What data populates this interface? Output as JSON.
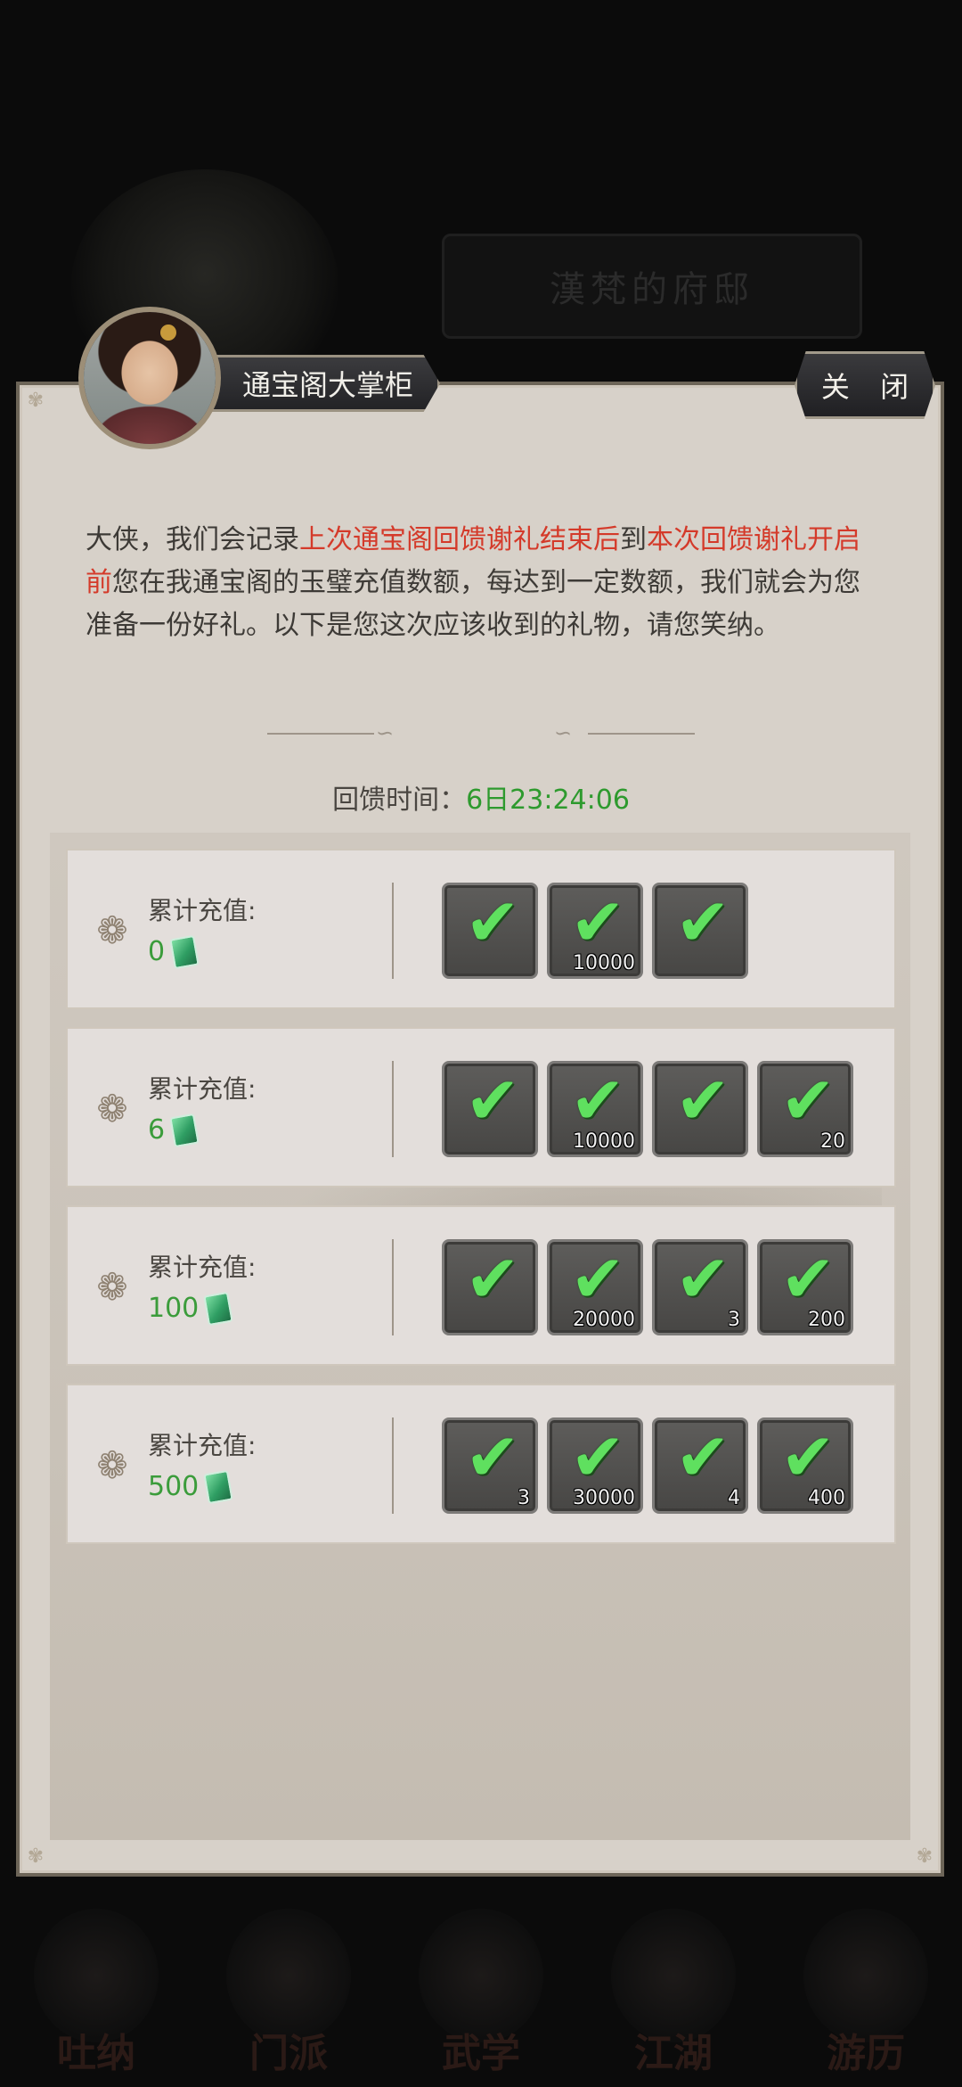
{
  "background": {
    "location_title": "漢梵的府邸",
    "bottom_nav": [
      "吐纳",
      "门派",
      "武学",
      "江湖",
      "游历"
    ]
  },
  "dialog": {
    "npc_name": "通宝阁大掌柜",
    "close_label": "关 闭",
    "description": {
      "part1": "大侠，我们会记录",
      "highlight1": "上次通宝阁回馈谢礼结束后",
      "part2": "到",
      "highlight2": "本次回馈谢礼开启前",
      "part3": "您在我通宝阁的玉璧充值数额，每达到一定数额，我们就会为您准备一份好礼。以下是您这次应该收到的礼物，请您笑纳。"
    },
    "timer_label": "回馈时间：",
    "timer_value": "6日23:24:06",
    "recharge_label": "累计充值:",
    "tiers": [
      {
        "amount": "0",
        "items": [
          "",
          "10000",
          ""
        ]
      },
      {
        "amount": "6",
        "items": [
          "",
          "10000",
          "",
          "20"
        ]
      },
      {
        "amount": "100",
        "items": [
          "",
          "20000",
          "3",
          "200"
        ]
      },
      {
        "amount": "500",
        "items": [
          "3",
          "30000",
          "4",
          "400"
        ]
      }
    ]
  },
  "colors": {
    "highlight": "#d43a2a",
    "timer_green": "#2e9a2e",
    "check_green": "#5fe05f"
  }
}
